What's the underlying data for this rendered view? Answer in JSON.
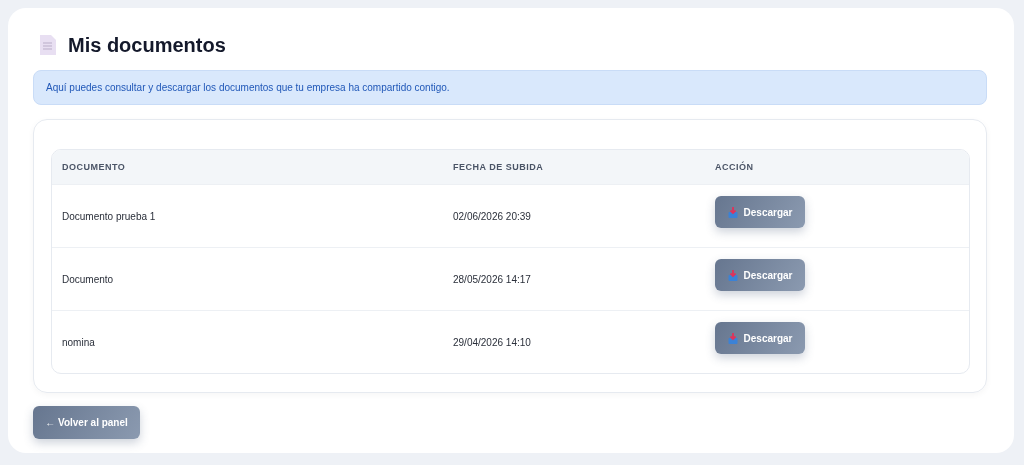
{
  "title": "Mis documentos",
  "info": "Aquí puedes consultar y descargar los documentos que tu empresa ha compartido contigo.",
  "table": {
    "columns": [
      "DOCUMENTO",
      "FECHA DE SUBIDA",
      "ACCIÓN"
    ],
    "rows": [
      {
        "document": "Documento prueba 1",
        "date": "02/06/2026 20:39",
        "action": "Descargar"
      },
      {
        "document": "Documento",
        "date": "28/05/2026 14:17",
        "action": "Descargar"
      },
      {
        "document": "nomina",
        "date": "29/04/2026 14:10",
        "action": "Descargar"
      }
    ]
  },
  "back_button": "← Volver al panel"
}
